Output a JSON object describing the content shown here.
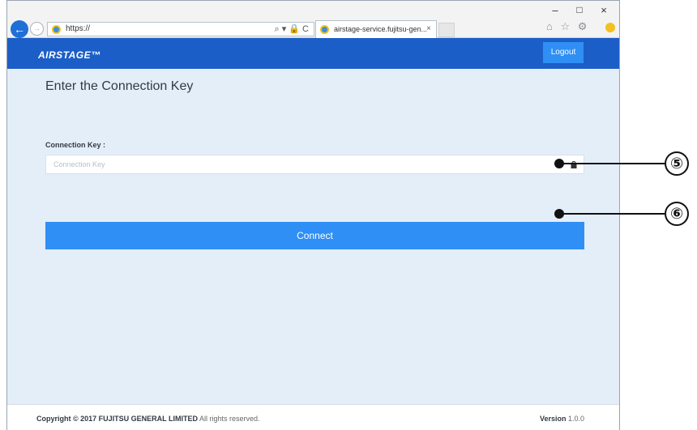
{
  "browser": {
    "url": "https://",
    "address_actions": "⌕ ▾ 🔒 C",
    "tab_title": "airstage-service.fujitsu-gen...",
    "tab_close": "×",
    "window_controls": {
      "minimize": "–",
      "maximize": "□",
      "close": "×"
    },
    "toolbar_icons": "⌂ ☆ ⚙"
  },
  "header": {
    "logo": "AIRSTAGE™",
    "logout_label": "Logout"
  },
  "main": {
    "title": "Enter the Connection Key",
    "field_label": "Connection Key :",
    "key_placeholder": "Connection Key",
    "key_value": "",
    "connect_label": "Connect"
  },
  "footer": {
    "copyright_prefix": "Copyright © 2017 FUJITSU GENERAL LIMITED",
    "copyright_suffix": "All rights reserved.",
    "version_label": "Version",
    "version_number": "1.0.0"
  },
  "callouts": {
    "key_field": "⑤",
    "connect_button": "⑥"
  },
  "colors": {
    "header": "#1b5ec7",
    "button": "#2f8ff5",
    "content_bg": "#e4eef9"
  }
}
